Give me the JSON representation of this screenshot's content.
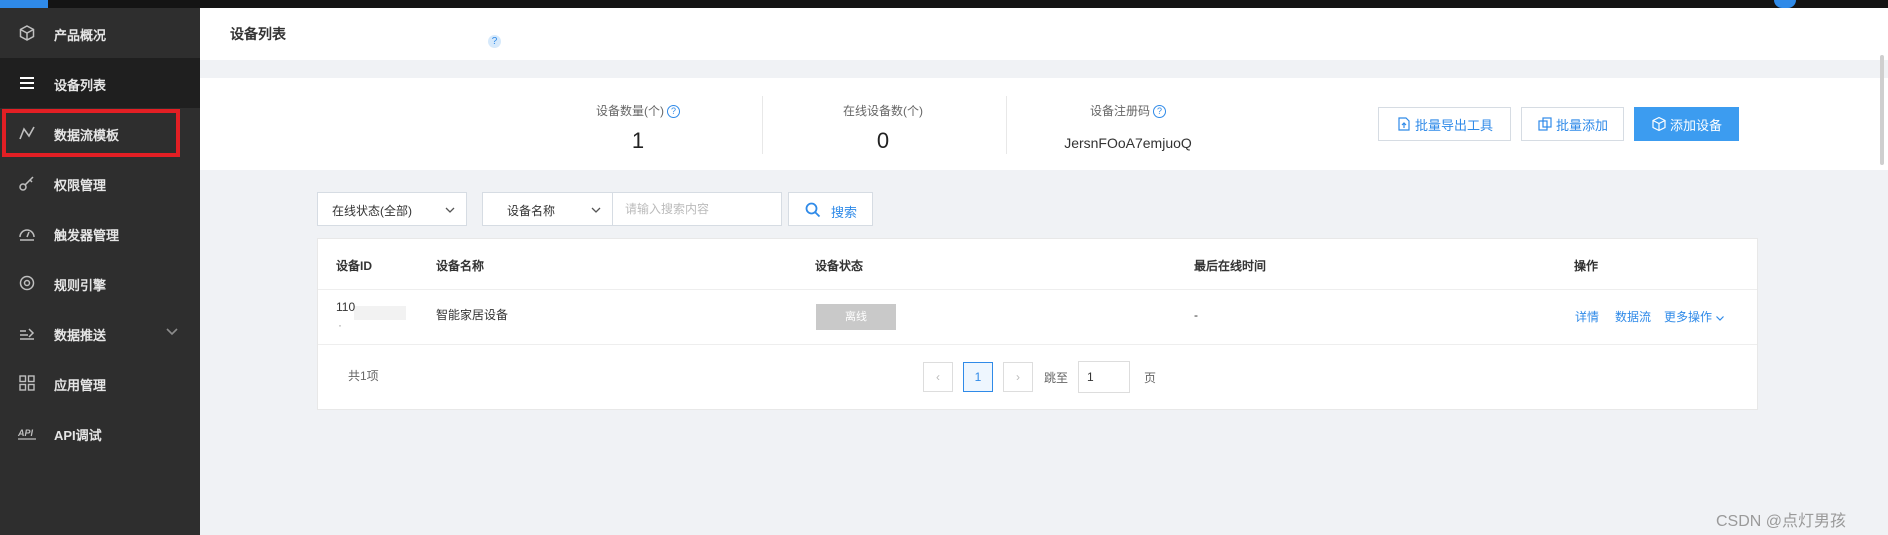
{
  "sidebar": {
    "items": [
      {
        "label": "产品概况",
        "icon": "cube-icon"
      },
      {
        "label": "设备列表",
        "icon": "list-icon"
      },
      {
        "label": "数据流模板",
        "icon": "chart-line-icon"
      },
      {
        "label": "权限管理",
        "icon": "key-icon"
      },
      {
        "label": "触发器管理",
        "icon": "gauge-icon"
      },
      {
        "label": "规则引擎",
        "icon": "engine-icon"
      },
      {
        "label": "数据推送",
        "icon": "push-icon"
      },
      {
        "label": "应用管理",
        "icon": "grid-icon"
      },
      {
        "label": "API调试",
        "icon": "api-icon"
      }
    ]
  },
  "header": {
    "title": "设备列表",
    "help": "?"
  },
  "stats": {
    "device_count_label": "设备数量(个)",
    "device_count": "1",
    "online_count_label": "在线设备数(个)",
    "online_count": "0",
    "reg_code_label": "设备注册码",
    "reg_code": "JersnFOoA7emjuoQ"
  },
  "actions": {
    "export": "批量导出工具",
    "batch_add": "批量添加",
    "add_device": "添加设备"
  },
  "filters": {
    "status": "在线状态(全部)",
    "field": "设备名称",
    "search_placeholder": "请输入搜索内容",
    "search_button": "搜索"
  },
  "table": {
    "headers": [
      "设备ID",
      "设备名称",
      "设备状态",
      "最后在线时间",
      "操作"
    ],
    "rows": [
      {
        "id": "110",
        "dot": "·",
        "name": "智能家居设备",
        "status": "离线",
        "last_online": "-"
      }
    ],
    "row_actions": {
      "detail": "详情",
      "datastream": "数据流",
      "more": "更多操作"
    }
  },
  "pagination": {
    "total": "共1项",
    "current": "1",
    "jump_label": "跳至",
    "jump_value": "1",
    "page_unit": "页"
  },
  "watermark": "CSDN @点灯男孩",
  "colors": {
    "accent": "#2f8ae8",
    "sidebar": "#2e2e2e",
    "highlight": "#e21f24",
    "primary_button": "#3c9cf0"
  }
}
